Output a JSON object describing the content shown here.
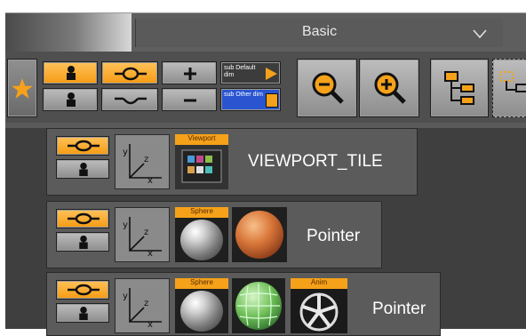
{
  "header": {
    "preset_dropdown": {
      "value": "Basic"
    }
  },
  "toolbar": {
    "sub_default_label": "sub Default dim",
    "sub_other_label": "sub Other dim"
  },
  "tree": {
    "nodes": [
      {
        "label": "VIEWPORT_TILE",
        "thumbnail_tags": [
          "Viewport"
        ]
      },
      {
        "label": "Pointer",
        "thumbnail_tags": [
          "Sphere"
        ]
      },
      {
        "label": "Pointer",
        "thumbnail_tags": [
          "Sphere",
          "Anim"
        ]
      }
    ]
  },
  "colors": {
    "accent_orange": "#f59b12",
    "panel_dark": "#3f3f3f",
    "node_bg": "#5b5b5b"
  }
}
